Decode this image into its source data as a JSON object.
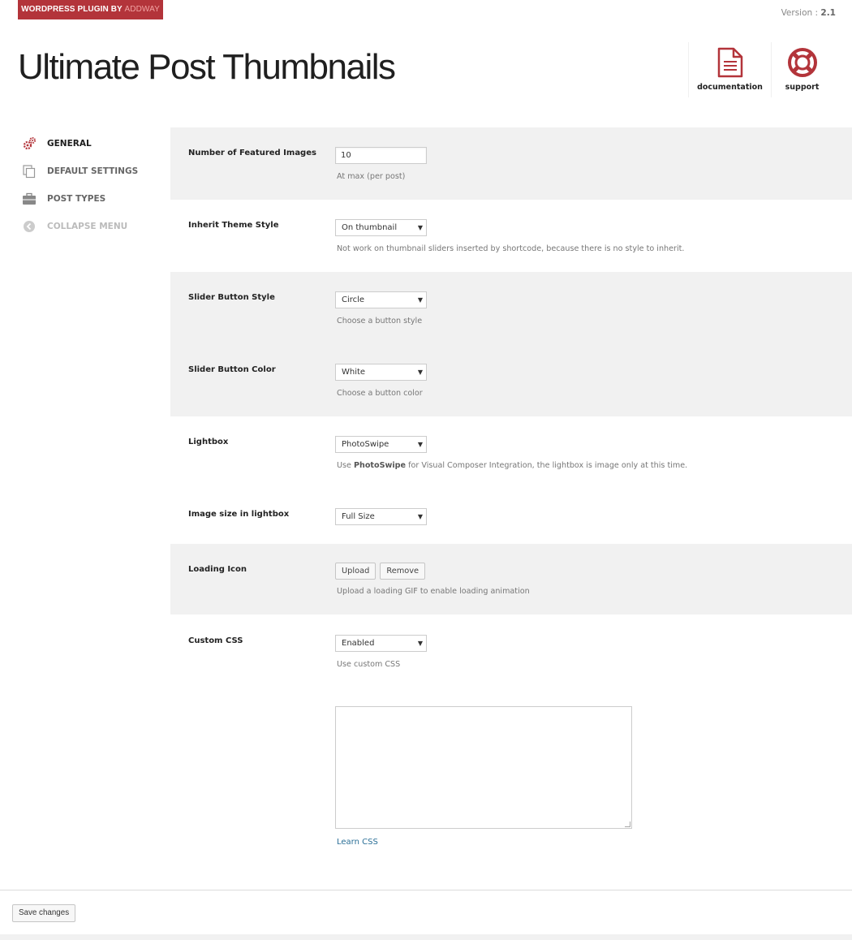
{
  "badge": {
    "prefix": "WORDPRESS PLUGIN BY ",
    "brand": "ADDWAY"
  },
  "version": {
    "label": "Version : ",
    "number": "2.1"
  },
  "title": "Ultimate Post Thumbnails",
  "header_links": {
    "documentation": "documentation",
    "support": "support"
  },
  "nav": {
    "general": "GENERAL",
    "default_settings": "DEFAULT SETTINGS",
    "post_types": "POST TYPES",
    "collapse": "COLLAPSE MENU"
  },
  "settings": {
    "featured": {
      "label": "Number of Featured Images",
      "value": "10",
      "desc": "At max (per post)"
    },
    "inherit": {
      "label": "Inherit Theme Style",
      "value": "On thumbnail",
      "desc": "Not work on thumbnail sliders inserted by shortcode, because there is no style to inherit."
    },
    "button_style": {
      "label": "Slider Button Style",
      "value": "Circle",
      "desc": "Choose a button style"
    },
    "button_color": {
      "label": "Slider Button Color",
      "value": "White",
      "desc": "Choose a button color"
    },
    "lightbox": {
      "label": "Lightbox",
      "value": "PhotoSwipe",
      "desc_pre": "Use ",
      "desc_bold": "PhotoSwipe",
      "desc_post": " for Visual Composer Integration, the lightbox is image only at this time."
    },
    "image_size": {
      "label": "Image size in lightbox",
      "value": "Full Size"
    },
    "loading": {
      "label": "Loading Icon",
      "upload": "Upload",
      "remove": "Remove",
      "desc": "Upload a loading GIF to enable loading animation"
    },
    "custom_css": {
      "label": "Custom CSS",
      "value": "Enabled",
      "desc": "Use custom CSS",
      "textarea": "",
      "learn": "Learn CSS"
    }
  },
  "footer": {
    "save": "Save changes"
  },
  "colors": {
    "accent": "#b3343a",
    "band": "#f1f1f1",
    "link": "#2a6f97"
  }
}
